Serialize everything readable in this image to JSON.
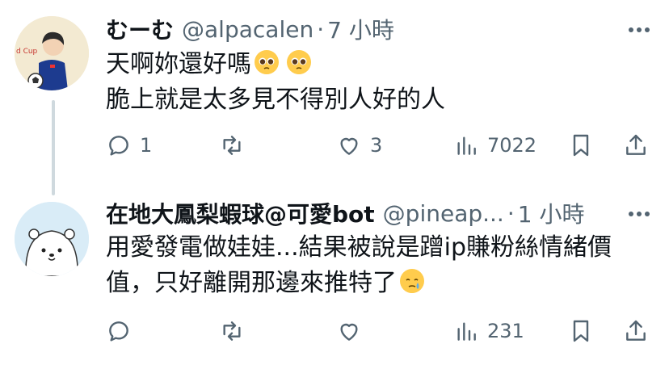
{
  "tweets": [
    {
      "author_name": "むーむ",
      "handle": "@alpacalen",
      "separator": "·",
      "time": "7 小時",
      "lines": [
        "天啊妳還好嗎",
        "脆上就是太多見不得別人好的人"
      ],
      "emojis": [
        "pleading-face",
        "pleading-face"
      ],
      "avatar_text": "d Cup",
      "replies": "1",
      "retweets": "",
      "likes": "3",
      "views": "7022"
    },
    {
      "author_name": "在地大鳳梨蝦球@可愛bot",
      "handle": "@pineap...",
      "separator": "·",
      "time": "1 小時",
      "lines": [
        "用愛發電做娃娃...結果被說是蹭ip賺粉絲情緒價",
        "值，只好離開那邊來推特了"
      ],
      "emojis": [
        "face-holding-back-tears"
      ],
      "replies": "",
      "retweets": "",
      "likes": "",
      "views": "231"
    }
  ],
  "colors": {
    "text": "#0f1419",
    "secondary": "#536471",
    "thread_line": "#cfd9de",
    "emoji": "#ffcc4d"
  }
}
